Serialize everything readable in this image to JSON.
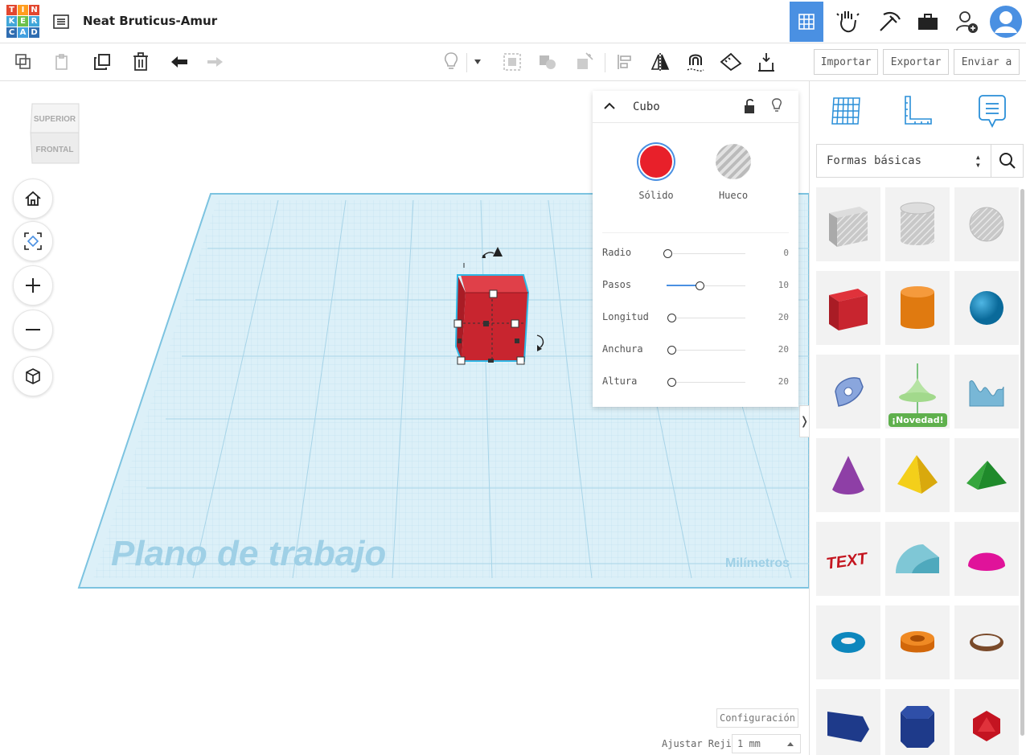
{
  "app": {
    "logo_letters": [
      "T",
      "I",
      "N",
      "K",
      "E",
      "R",
      "C",
      "A",
      "D"
    ],
    "design_title": "Neat Bruticus-Amur"
  },
  "toolbar": {
    "import_label": "Importar",
    "export_label": "Exportar",
    "send_label": "Enviar a"
  },
  "view_cube": {
    "top_label": "SUPERIOR",
    "front_label": "FRONTAL"
  },
  "workplane": {
    "label": "Plano de trabajo",
    "units_label": "Milímetros"
  },
  "inspector": {
    "title": "Cubo",
    "solid_label": "Sólido",
    "hole_label": "Hueco",
    "solid_color": "#e8202a",
    "params": [
      {
        "label": "Radio",
        "value": "0",
        "level": 0
      },
      {
        "label": "Pasos",
        "value": "10",
        "level": 0.44
      },
      {
        "label": "Longitud",
        "value": "20",
        "level": 0.06
      },
      {
        "label": "Anchura",
        "value": "20",
        "level": 0.06
      },
      {
        "label": "Altura",
        "value": "20",
        "level": 0.06
      }
    ]
  },
  "settings": {
    "config_label": "Configuración",
    "snap_label": "Ajustar Rejilla",
    "snap_value": "1 mm"
  },
  "shapes_panel": {
    "category": "Formas básicas",
    "new_badge": "¡Novedad!",
    "shapes": [
      "box-hole",
      "cylinder-hole",
      "sphere-hole",
      "box",
      "cylinder",
      "sphere",
      "scribble",
      "paraboloid-new",
      "shape-generator",
      "cone",
      "pyramid",
      "roof",
      "text",
      "half-cylinder",
      "half-sphere",
      "torus",
      "tube",
      "ring",
      "wedge",
      "polygon",
      "icosahedron"
    ]
  },
  "colors": {
    "accent": "#4a90e2",
    "workplane": "#cfe8f3",
    "workplane_line": "#8ccbe6",
    "cube_red": "#d9242f"
  }
}
